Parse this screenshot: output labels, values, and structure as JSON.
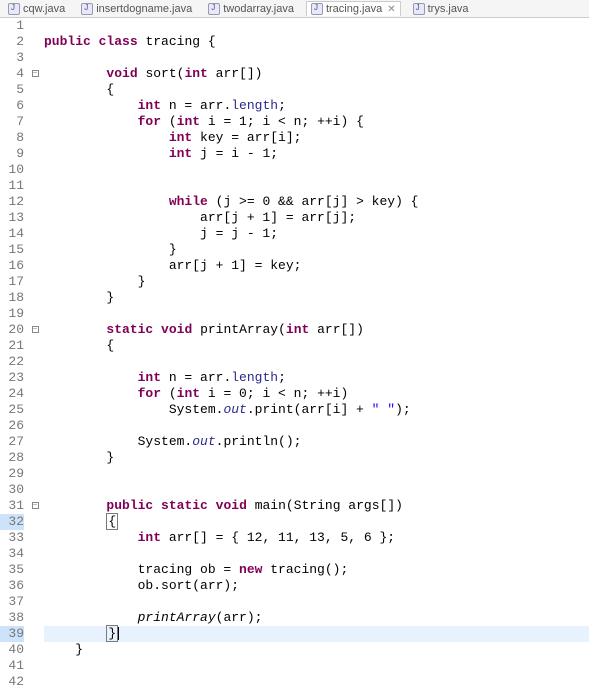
{
  "tabs": [
    {
      "label": "cqw.java"
    },
    {
      "label": "insertdogname.java"
    },
    {
      "label": "twodarray.java"
    },
    {
      "label": "tracing.java",
      "active": true
    },
    {
      "label": "trys.java"
    }
  ],
  "line_count": 42,
  "fold_markers": {
    "4": "⊖",
    "20": "⊖",
    "31": "⊖"
  },
  "highlight_lines": [
    39
  ],
  "bracket_highlight_lines": [
    32,
    39
  ],
  "chart_data": {
    "type": "table",
    "title": "Java source: tracing.java",
    "lines": [
      {
        "n": 1,
        "tokens": []
      },
      {
        "n": 2,
        "tokens": [
          [
            "k",
            "public"
          ],
          [
            "n",
            " "
          ],
          [
            "k",
            "class"
          ],
          [
            "n",
            " tracing {"
          ]
        ]
      },
      {
        "n": 3,
        "tokens": []
      },
      {
        "n": 4,
        "tokens": [
          [
            "n",
            "        "
          ],
          [
            "k",
            "void"
          ],
          [
            "n",
            " sort("
          ],
          [
            "k",
            "int"
          ],
          [
            "n",
            " arr[])"
          ]
        ]
      },
      {
        "n": 5,
        "tokens": [
          [
            "n",
            "        {"
          ]
        ]
      },
      {
        "n": 6,
        "tokens": [
          [
            "n",
            "            "
          ],
          [
            "k",
            "int"
          ],
          [
            "n",
            " n = arr."
          ],
          [
            "f",
            "length"
          ],
          [
            "n",
            ";"
          ]
        ]
      },
      {
        "n": 7,
        "tokens": [
          [
            "n",
            "            "
          ],
          [
            "k",
            "for"
          ],
          [
            "n",
            " ("
          ],
          [
            "k",
            "int"
          ],
          [
            "n",
            " i = 1; i < n; ++i) {"
          ]
        ]
      },
      {
        "n": 8,
        "tokens": [
          [
            "n",
            "                "
          ],
          [
            "k",
            "int"
          ],
          [
            "n",
            " key = arr[i];"
          ]
        ]
      },
      {
        "n": 9,
        "tokens": [
          [
            "n",
            "                "
          ],
          [
            "k",
            "int"
          ],
          [
            "n",
            " j = i - 1;"
          ]
        ]
      },
      {
        "n": 10,
        "tokens": []
      },
      {
        "n": 11,
        "tokens": []
      },
      {
        "n": 12,
        "tokens": [
          [
            "n",
            "                "
          ],
          [
            "k",
            "while"
          ],
          [
            "n",
            " (j >= 0 && arr[j] > key) {"
          ]
        ]
      },
      {
        "n": 13,
        "tokens": [
          [
            "n",
            "                    arr[j + 1] = arr[j];"
          ]
        ]
      },
      {
        "n": 14,
        "tokens": [
          [
            "n",
            "                    j = j - 1;"
          ]
        ]
      },
      {
        "n": 15,
        "tokens": [
          [
            "n",
            "                }"
          ]
        ]
      },
      {
        "n": 16,
        "tokens": [
          [
            "n",
            "                arr[j + 1] = key;"
          ]
        ]
      },
      {
        "n": 17,
        "tokens": [
          [
            "n",
            "            }"
          ]
        ]
      },
      {
        "n": 18,
        "tokens": [
          [
            "n",
            "        }"
          ]
        ]
      },
      {
        "n": 19,
        "tokens": []
      },
      {
        "n": 20,
        "tokens": [
          [
            "n",
            "        "
          ],
          [
            "k",
            "static"
          ],
          [
            "n",
            " "
          ],
          [
            "k",
            "void"
          ],
          [
            "n",
            " printArray("
          ],
          [
            "k",
            "int"
          ],
          [
            "n",
            " arr[])"
          ]
        ]
      },
      {
        "n": 21,
        "tokens": [
          [
            "n",
            "        {"
          ]
        ]
      },
      {
        "n": 22,
        "tokens": []
      },
      {
        "n": 23,
        "tokens": [
          [
            "n",
            "            "
          ],
          [
            "k",
            "int"
          ],
          [
            "n",
            " n = arr."
          ],
          [
            "f",
            "length"
          ],
          [
            "n",
            ";"
          ]
        ]
      },
      {
        "n": 24,
        "tokens": [
          [
            "n",
            "            "
          ],
          [
            "k",
            "for"
          ],
          [
            "n",
            " ("
          ],
          [
            "k",
            "int"
          ],
          [
            "n",
            " i = 0; i < n; ++i)"
          ]
        ]
      },
      {
        "n": 25,
        "tokens": [
          [
            "n",
            "                System."
          ],
          [
            "fit",
            "out"
          ],
          [
            "n",
            ".print(arr[i] + "
          ],
          [
            "s",
            "\" \""
          ],
          [
            "n",
            ");"
          ]
        ]
      },
      {
        "n": 26,
        "tokens": []
      },
      {
        "n": 27,
        "tokens": [
          [
            "n",
            "            System."
          ],
          [
            "fit",
            "out"
          ],
          [
            "n",
            ".println();"
          ]
        ]
      },
      {
        "n": 28,
        "tokens": [
          [
            "n",
            "        }"
          ]
        ]
      },
      {
        "n": 29,
        "tokens": []
      },
      {
        "n": 30,
        "tokens": []
      },
      {
        "n": 31,
        "tokens": [
          [
            "n",
            "        "
          ],
          [
            "k",
            "public"
          ],
          [
            "n",
            " "
          ],
          [
            "k",
            "static"
          ],
          [
            "n",
            " "
          ],
          [
            "k",
            "void"
          ],
          [
            "n",
            " main(String args[])"
          ]
        ]
      },
      {
        "n": 32,
        "tokens": [
          [
            "n",
            "        {"
          ]
        ]
      },
      {
        "n": 33,
        "tokens": [
          [
            "n",
            "            "
          ],
          [
            "k",
            "int"
          ],
          [
            "n",
            " arr[] = { 12, 11, 13, 5, 6 };"
          ]
        ]
      },
      {
        "n": 34,
        "tokens": []
      },
      {
        "n": 35,
        "tokens": [
          [
            "n",
            "            tracing ob = "
          ],
          [
            "k",
            "new"
          ],
          [
            "n",
            " tracing();"
          ]
        ]
      },
      {
        "n": 36,
        "tokens": [
          [
            "n",
            "            ob.sort(arr);"
          ]
        ]
      },
      {
        "n": 37,
        "tokens": []
      },
      {
        "n": 38,
        "tokens": [
          [
            "n",
            "            "
          ],
          [
            "it",
            "printArray"
          ],
          [
            "n",
            "(arr);"
          ]
        ]
      },
      {
        "n": 39,
        "tokens": [
          [
            "n",
            "        }"
          ]
        ]
      },
      {
        "n": 40,
        "tokens": [
          [
            "n",
            "    }"
          ]
        ]
      },
      {
        "n": 41,
        "tokens": []
      },
      {
        "n": 42,
        "tokens": []
      }
    ]
  }
}
